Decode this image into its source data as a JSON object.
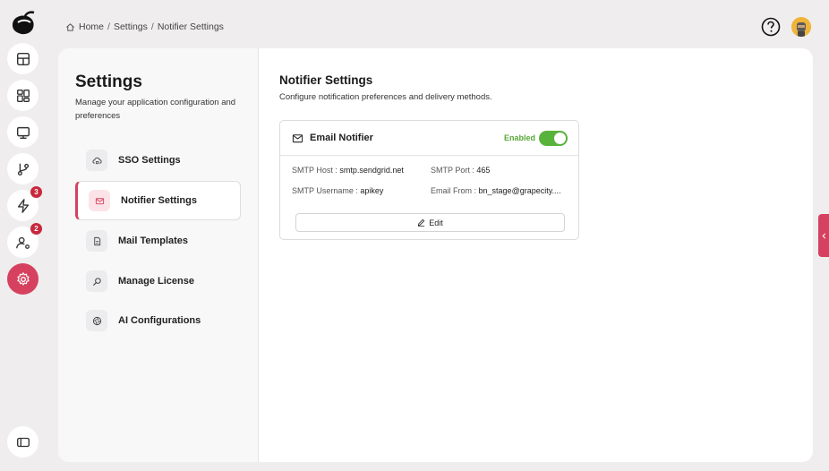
{
  "breadcrumb": {
    "home": "Home",
    "settings": "Settings",
    "current": "Notifier Settings",
    "separator": "/"
  },
  "rail": {
    "badges": {
      "alerts": "3",
      "users": "2"
    }
  },
  "settings_nav": {
    "title": "Settings",
    "description": "Manage your application configuration and preferences",
    "items": [
      {
        "label": "SSO Settings",
        "icon": "cloud-lock-icon"
      },
      {
        "label": "Notifier Settings",
        "icon": "mail-icon",
        "active": true
      },
      {
        "label": "Mail Templates",
        "icon": "document-icon"
      },
      {
        "label": "Manage License",
        "icon": "key-search-icon"
      },
      {
        "label": "AI Configurations",
        "icon": "ai-aperture-icon"
      }
    ]
  },
  "content": {
    "title": "Notifier Settings",
    "description": "Configure notification preferences and delivery methods."
  },
  "email_notifier": {
    "title": "Email Notifier",
    "status_label": "Enabled",
    "enabled": true,
    "smtp_host_label": "SMTP Host :",
    "smtp_host": "smtp.sendgrid.net",
    "smtp_port_label": "SMTP Port :",
    "smtp_port": "465",
    "smtp_username_label": "SMTP Username :",
    "smtp_username": "apikey",
    "email_from_label": "Email From :",
    "email_from": "bn_stage@grapecity....",
    "edit_label": "Edit"
  },
  "colors": {
    "accent": "#d64160",
    "enabled": "#58b33a",
    "background": "#efeded"
  }
}
